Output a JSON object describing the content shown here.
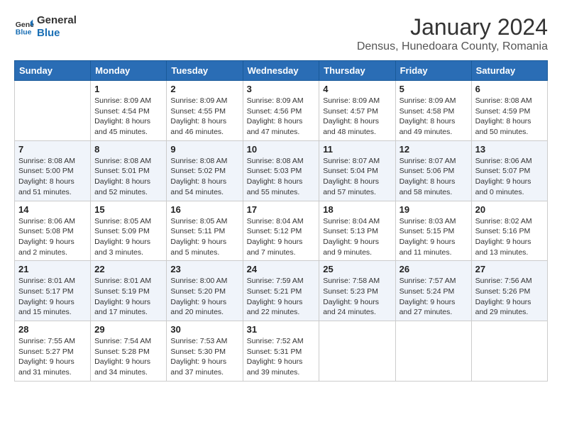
{
  "header": {
    "logo_line1": "General",
    "logo_line2": "Blue",
    "main_title": "January 2024",
    "subtitle": "Densus, Hunedoara County, Romania"
  },
  "days_of_week": [
    "Sunday",
    "Monday",
    "Tuesday",
    "Wednesday",
    "Thursday",
    "Friday",
    "Saturday"
  ],
  "weeks": [
    [
      {
        "day": "",
        "info": ""
      },
      {
        "day": "1",
        "info": "Sunrise: 8:09 AM\nSunset: 4:54 PM\nDaylight: 8 hours\nand 45 minutes."
      },
      {
        "day": "2",
        "info": "Sunrise: 8:09 AM\nSunset: 4:55 PM\nDaylight: 8 hours\nand 46 minutes."
      },
      {
        "day": "3",
        "info": "Sunrise: 8:09 AM\nSunset: 4:56 PM\nDaylight: 8 hours\nand 47 minutes."
      },
      {
        "day": "4",
        "info": "Sunrise: 8:09 AM\nSunset: 4:57 PM\nDaylight: 8 hours\nand 48 minutes."
      },
      {
        "day": "5",
        "info": "Sunrise: 8:09 AM\nSunset: 4:58 PM\nDaylight: 8 hours\nand 49 minutes."
      },
      {
        "day": "6",
        "info": "Sunrise: 8:08 AM\nSunset: 4:59 PM\nDaylight: 8 hours\nand 50 minutes."
      }
    ],
    [
      {
        "day": "7",
        "info": "Sunrise: 8:08 AM\nSunset: 5:00 PM\nDaylight: 8 hours\nand 51 minutes."
      },
      {
        "day": "8",
        "info": "Sunrise: 8:08 AM\nSunset: 5:01 PM\nDaylight: 8 hours\nand 52 minutes."
      },
      {
        "day": "9",
        "info": "Sunrise: 8:08 AM\nSunset: 5:02 PM\nDaylight: 8 hours\nand 54 minutes."
      },
      {
        "day": "10",
        "info": "Sunrise: 8:08 AM\nSunset: 5:03 PM\nDaylight: 8 hours\nand 55 minutes."
      },
      {
        "day": "11",
        "info": "Sunrise: 8:07 AM\nSunset: 5:04 PM\nDaylight: 8 hours\nand 57 minutes."
      },
      {
        "day": "12",
        "info": "Sunrise: 8:07 AM\nSunset: 5:06 PM\nDaylight: 8 hours\nand 58 minutes."
      },
      {
        "day": "13",
        "info": "Sunrise: 8:06 AM\nSunset: 5:07 PM\nDaylight: 9 hours\nand 0 minutes."
      }
    ],
    [
      {
        "day": "14",
        "info": "Sunrise: 8:06 AM\nSunset: 5:08 PM\nDaylight: 9 hours\nand 2 minutes."
      },
      {
        "day": "15",
        "info": "Sunrise: 8:05 AM\nSunset: 5:09 PM\nDaylight: 9 hours\nand 3 minutes."
      },
      {
        "day": "16",
        "info": "Sunrise: 8:05 AM\nSunset: 5:11 PM\nDaylight: 9 hours\nand 5 minutes."
      },
      {
        "day": "17",
        "info": "Sunrise: 8:04 AM\nSunset: 5:12 PM\nDaylight: 9 hours\nand 7 minutes."
      },
      {
        "day": "18",
        "info": "Sunrise: 8:04 AM\nSunset: 5:13 PM\nDaylight: 9 hours\nand 9 minutes."
      },
      {
        "day": "19",
        "info": "Sunrise: 8:03 AM\nSunset: 5:15 PM\nDaylight: 9 hours\nand 11 minutes."
      },
      {
        "day": "20",
        "info": "Sunrise: 8:02 AM\nSunset: 5:16 PM\nDaylight: 9 hours\nand 13 minutes."
      }
    ],
    [
      {
        "day": "21",
        "info": "Sunrise: 8:01 AM\nSunset: 5:17 PM\nDaylight: 9 hours\nand 15 minutes."
      },
      {
        "day": "22",
        "info": "Sunrise: 8:01 AM\nSunset: 5:19 PM\nDaylight: 9 hours\nand 17 minutes."
      },
      {
        "day": "23",
        "info": "Sunrise: 8:00 AM\nSunset: 5:20 PM\nDaylight: 9 hours\nand 20 minutes."
      },
      {
        "day": "24",
        "info": "Sunrise: 7:59 AM\nSunset: 5:21 PM\nDaylight: 9 hours\nand 22 minutes."
      },
      {
        "day": "25",
        "info": "Sunrise: 7:58 AM\nSunset: 5:23 PM\nDaylight: 9 hours\nand 24 minutes."
      },
      {
        "day": "26",
        "info": "Sunrise: 7:57 AM\nSunset: 5:24 PM\nDaylight: 9 hours\nand 27 minutes."
      },
      {
        "day": "27",
        "info": "Sunrise: 7:56 AM\nSunset: 5:26 PM\nDaylight: 9 hours\nand 29 minutes."
      }
    ],
    [
      {
        "day": "28",
        "info": "Sunrise: 7:55 AM\nSunset: 5:27 PM\nDaylight: 9 hours\nand 31 minutes."
      },
      {
        "day": "29",
        "info": "Sunrise: 7:54 AM\nSunset: 5:28 PM\nDaylight: 9 hours\nand 34 minutes."
      },
      {
        "day": "30",
        "info": "Sunrise: 7:53 AM\nSunset: 5:30 PM\nDaylight: 9 hours\nand 37 minutes."
      },
      {
        "day": "31",
        "info": "Sunrise: 7:52 AM\nSunset: 5:31 PM\nDaylight: 9 hours\nand 39 minutes."
      },
      {
        "day": "",
        "info": ""
      },
      {
        "day": "",
        "info": ""
      },
      {
        "day": "",
        "info": ""
      }
    ]
  ]
}
